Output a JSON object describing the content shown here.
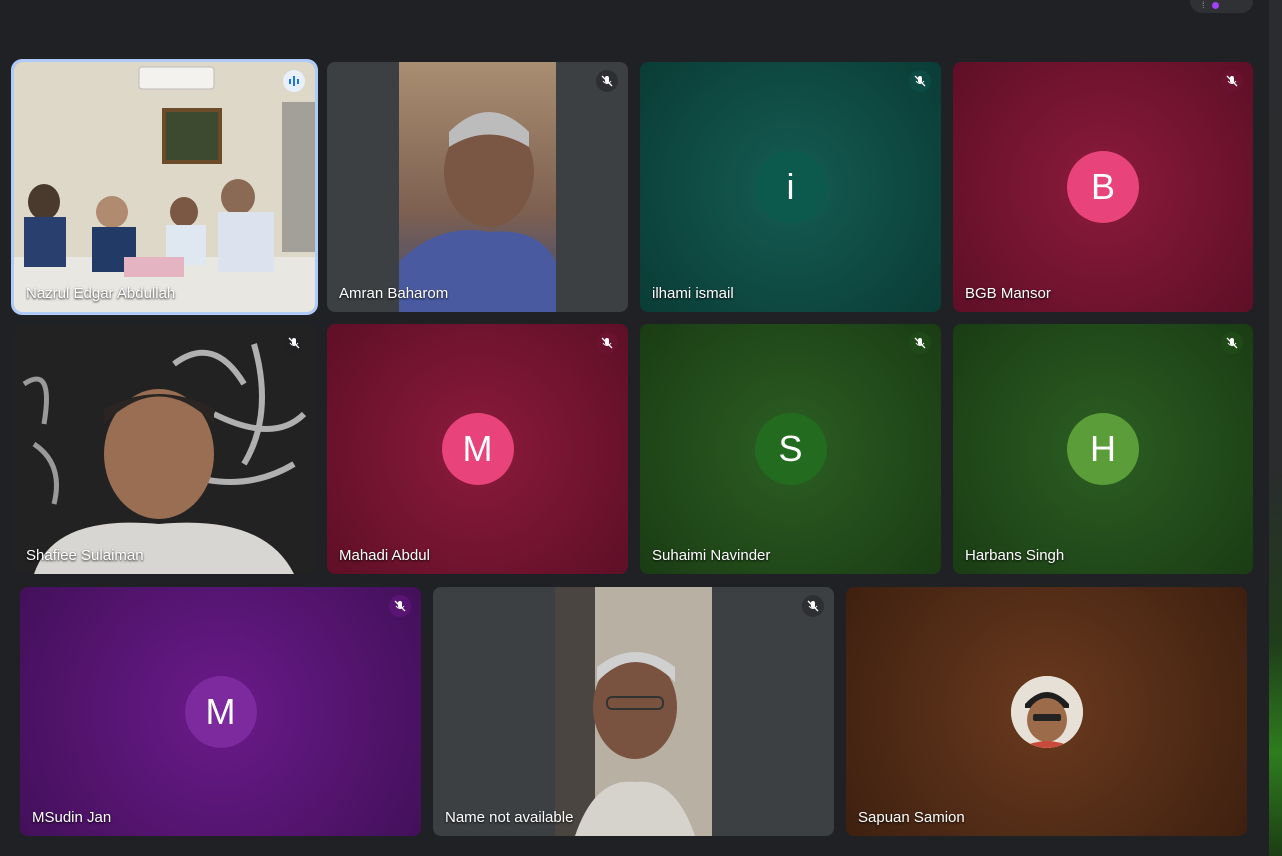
{
  "colors": {
    "speaking_ring": "#aecbfa",
    "tile_gray": "#3c4043",
    "page_bg": "#202124"
  },
  "participants": [
    {
      "name": "Nazrul Edgar Abdullah",
      "avatar_letter": "",
      "mic_state": "speaking",
      "has_video": true,
      "tile_color": "#8f8b7c"
    },
    {
      "name": "Amran Baharom",
      "avatar_letter": "",
      "mic_state": "muted",
      "has_video": true,
      "tile_color": "#3c4043"
    },
    {
      "name": "ilhami ismail",
      "avatar_letter": "i",
      "mic_state": "muted",
      "has_video": false,
      "tile_color": "#0d4a43",
      "avatar_color": "#0b5a4d"
    },
    {
      "name": "BGB Mansor",
      "avatar_letter": "B",
      "mic_state": "muted",
      "has_video": false,
      "tile_color": "#7b1431",
      "avatar_color": "#e8437a"
    },
    {
      "name": "Shafiee Sulaiman",
      "avatar_letter": "",
      "mic_state": "muted",
      "has_video": true,
      "tile_color": "#2a2a2a"
    },
    {
      "name": "Mahadi Abdul",
      "avatar_letter": "M",
      "mic_state": "muted",
      "has_video": false,
      "tile_color": "#7b1431",
      "avatar_color": "#e8437a"
    },
    {
      "name": "Suhaimi Navinder",
      "avatar_letter": "S",
      "mic_state": "muted",
      "has_video": false,
      "tile_color": "#1f4a18",
      "avatar_color": "#226b1f"
    },
    {
      "name": "Harbans Singh",
      "avatar_letter": "H",
      "mic_state": "muted",
      "has_video": false,
      "tile_color": "#1f4a18",
      "avatar_color": "#5b9e39"
    },
    {
      "name": "MSudin Jan",
      "avatar_letter": "M",
      "mic_state": "muted",
      "has_video": false,
      "tile_color": "#5a1473",
      "avatar_color": "#7d2a9e"
    },
    {
      "name": "Name not available",
      "avatar_letter": "",
      "mic_state": "muted",
      "has_video": true,
      "tile_color": "#3c4043"
    },
    {
      "name": "Sapuan Samion",
      "avatar_letter": "",
      "mic_state": "none",
      "has_video": false,
      "tile_color": "#4e2a17",
      "avatar_photo": true
    }
  ]
}
